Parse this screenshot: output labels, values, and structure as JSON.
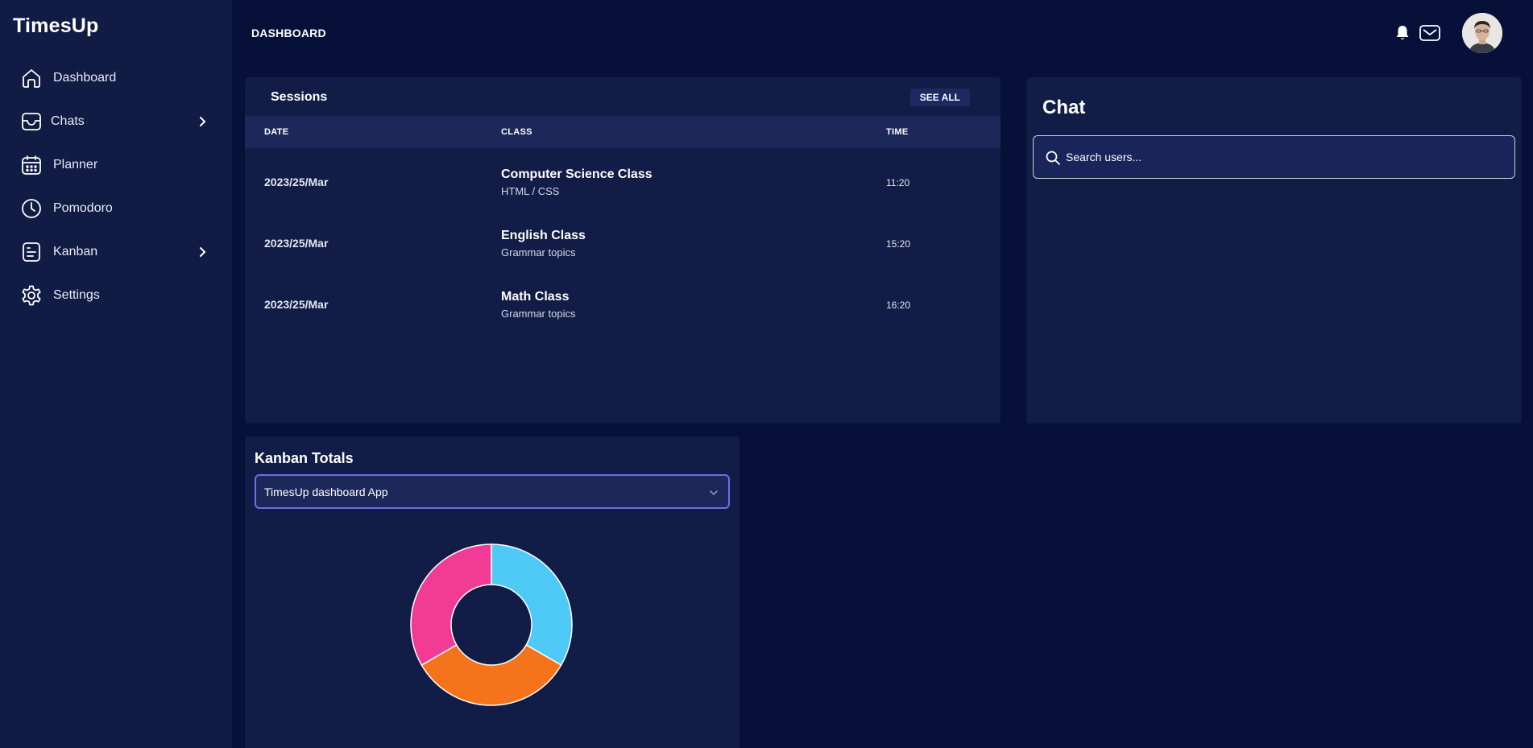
{
  "brand": "TimesUp",
  "sidebar": {
    "items": [
      {
        "label": "Dashboard",
        "icon": "home-icon"
      },
      {
        "label": "Chats",
        "icon": "inbox-icon",
        "has_submenu": true
      },
      {
        "label": "Planner",
        "icon": "calendar-icon"
      },
      {
        "label": "Pomodoro",
        "icon": "clock-icon"
      },
      {
        "label": "Kanban",
        "icon": "document-icon",
        "has_submenu": true
      },
      {
        "label": "Settings",
        "icon": "gear-icon"
      }
    ]
  },
  "header": {
    "title": "DASHBOARD",
    "icons": [
      "bell-icon",
      "mail-icon",
      "avatar"
    ]
  },
  "sessions": {
    "title": "Sessions",
    "see_all": "SEE ALL",
    "columns": {
      "date": "DATE",
      "class": "CLASS",
      "time": "TIME"
    },
    "rows": [
      {
        "date": "2023/25/Mar",
        "class": "Computer Science Class",
        "subtitle": "HTML / CSS",
        "time": "11:20"
      },
      {
        "date": "2023/25/Mar",
        "class": "English Class",
        "subtitle": "Grammar topics",
        "time": "15:20"
      },
      {
        "date": "2023/25/Mar",
        "class": "Math Class",
        "subtitle": "Grammar topics",
        "time": "16:20"
      }
    ]
  },
  "chat": {
    "title": "Chat",
    "search_placeholder": "Search users..."
  },
  "kanban": {
    "title": "Kanban Totals",
    "selected_project": "TimesUp dashboard App"
  },
  "colors": {
    "background": "#061039",
    "sidebar": "#111c45",
    "card": "#121d47",
    "accent_border": "#6a70e8"
  },
  "chart_data": {
    "type": "pie",
    "donut": true,
    "slices": [
      {
        "value": 1,
        "color": "#4fc9f5"
      },
      {
        "value": 1,
        "color": "#f5731b"
      },
      {
        "value": 1,
        "color": "#f23b95"
      }
    ]
  }
}
